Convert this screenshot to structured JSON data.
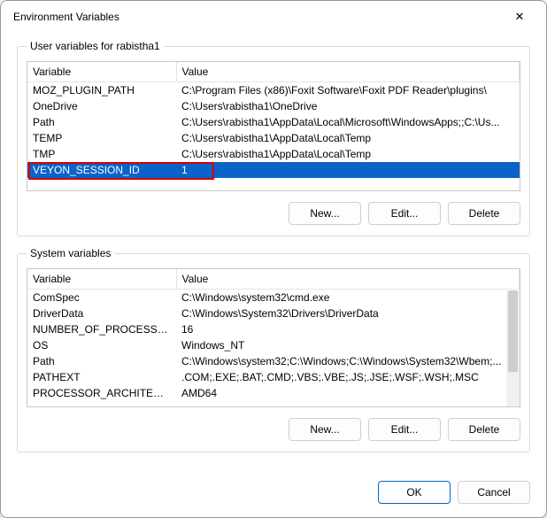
{
  "dialog": {
    "title": "Environment Variables",
    "close_glyph": "✕"
  },
  "user": {
    "legend": "User variables for rabistha1",
    "col_variable": "Variable",
    "col_value": "Value",
    "rows": [
      {
        "name": "MOZ_PLUGIN_PATH",
        "value": "C:\\Program Files (x86)\\Foxit Software\\Foxit PDF Reader\\plugins\\"
      },
      {
        "name": "OneDrive",
        "value": "C:\\Users\\rabistha1\\OneDrive"
      },
      {
        "name": "Path",
        "value": "C:\\Users\\rabistha1\\AppData\\Local\\Microsoft\\WindowsApps;;C:\\Us..."
      },
      {
        "name": "TEMP",
        "value": "C:\\Users\\rabistha1\\AppData\\Local\\Temp"
      },
      {
        "name": "TMP",
        "value": "C:\\Users\\rabistha1\\AppData\\Local\\Temp"
      },
      {
        "name": "VEYON_SESSION_ID",
        "value": "1"
      }
    ],
    "selected_index": 5,
    "highlight_index": 5,
    "btn_new": "New...",
    "btn_edit": "Edit...",
    "btn_delete": "Delete"
  },
  "system": {
    "legend": "System variables",
    "col_variable": "Variable",
    "col_value": "Value",
    "rows": [
      {
        "name": "ComSpec",
        "value": "C:\\Windows\\system32\\cmd.exe"
      },
      {
        "name": "DriverData",
        "value": "C:\\Windows\\System32\\Drivers\\DriverData"
      },
      {
        "name": "NUMBER_OF_PROCESSORS",
        "value": "16"
      },
      {
        "name": "OS",
        "value": "Windows_NT"
      },
      {
        "name": "Path",
        "value": "C:\\Windows\\system32;C:\\Windows;C:\\Windows\\System32\\Wbem;..."
      },
      {
        "name": "PATHEXT",
        "value": ".COM;.EXE;.BAT;.CMD;.VBS;.VBE;.JS;.JSE;.WSF;.WSH;.MSC"
      },
      {
        "name": "PROCESSOR_ARCHITECTURE",
        "value": "AMD64"
      }
    ],
    "btn_new": "New...",
    "btn_edit": "Edit...",
    "btn_delete": "Delete"
  },
  "footer": {
    "ok": "OK",
    "cancel": "Cancel"
  }
}
